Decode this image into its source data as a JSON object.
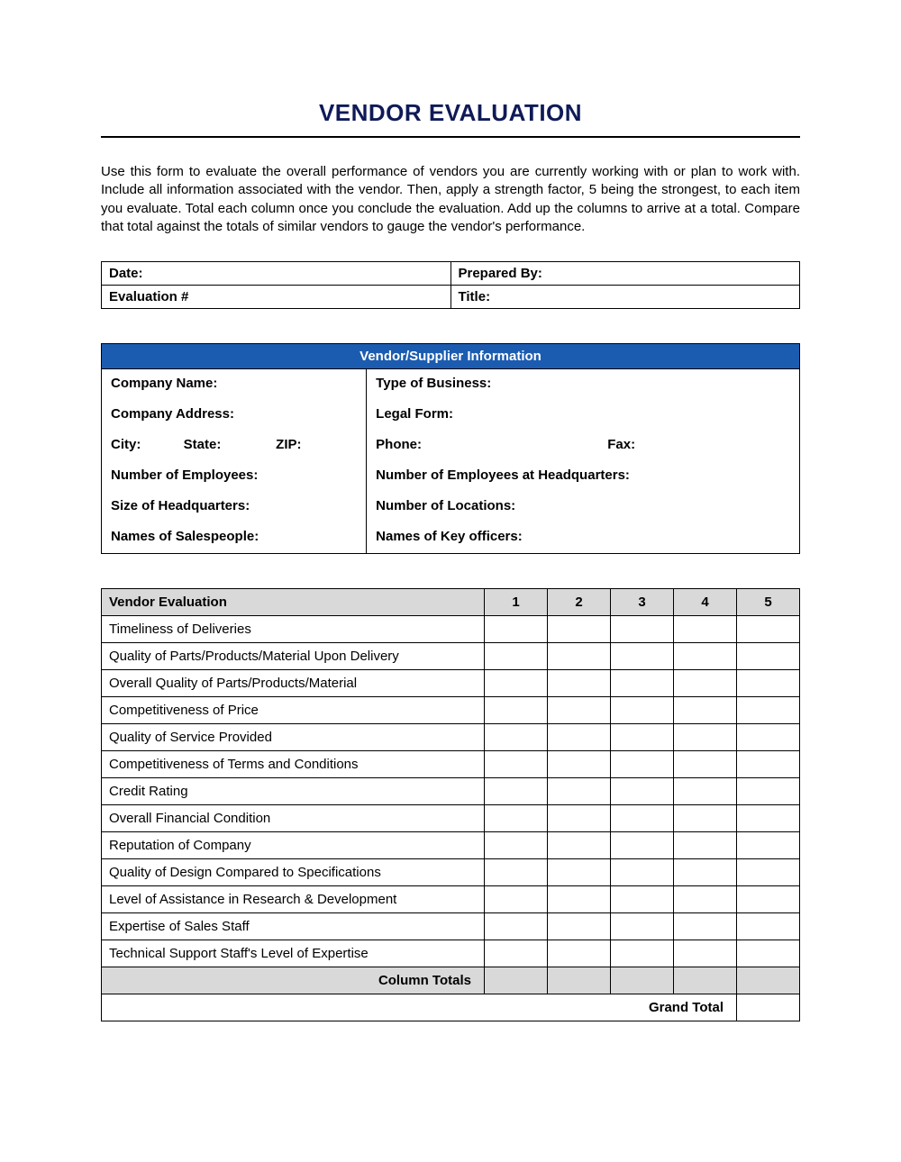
{
  "title": "VENDOR EVALUATION",
  "intro": "Use this form to evaluate the overall performance of vendors you are currently working with or plan to work with. Include all information associated with the vendor. Then, apply a strength factor, 5 being the strongest, to each item you evaluate. Total each column once you conclude the evaluation. Add up the columns to arrive at a total. Compare that total against the totals of similar vendors to gauge the vendor's performance.",
  "meta": {
    "date_label": "Date:",
    "prepared_by_label": "Prepared By:",
    "evaluation_no_label": "Evaluation #",
    "title_label": "Title:"
  },
  "vendor_info": {
    "section_header": "Vendor/Supplier Information",
    "company_name_label": "Company Name:",
    "type_of_business_label": "Type of Business:",
    "company_address_label": "Company Address:",
    "legal_form_label": "Legal Form:",
    "city_label": "City:",
    "state_label": "State:",
    "zip_label": "ZIP:",
    "phone_label": "Phone:",
    "fax_label": "Fax:",
    "num_employees_label": "Number of Employees:",
    "num_employees_hq_label": "Number of Employees at Headquarters:",
    "size_hq_label": "Size of Headquarters:",
    "num_locations_label": "Number of Locations:",
    "salespeople_label": "Names of Salespeople:",
    "key_officers_label": "Names of Key officers:"
  },
  "evaluation": {
    "header_label": "Vendor Evaluation",
    "columns": [
      "1",
      "2",
      "3",
      "4",
      "5"
    ],
    "criteria": [
      "Timeliness of Deliveries",
      "Quality of Parts/Products/Material Upon Delivery",
      "Overall Quality of Parts/Products/Material",
      "Competitiveness of Price",
      "Quality of Service Provided",
      "Competitiveness of Terms and Conditions",
      "Credit Rating",
      "Overall Financial Condition",
      "Reputation of Company",
      "Quality of Design Compared to Specifications",
      "Level of Assistance in Research & Development",
      "Expertise of Sales Staff",
      "Technical Support Staff's Level of Expertise"
    ],
    "column_totals_label": "Column Totals",
    "grand_total_label": "Grand Total"
  }
}
